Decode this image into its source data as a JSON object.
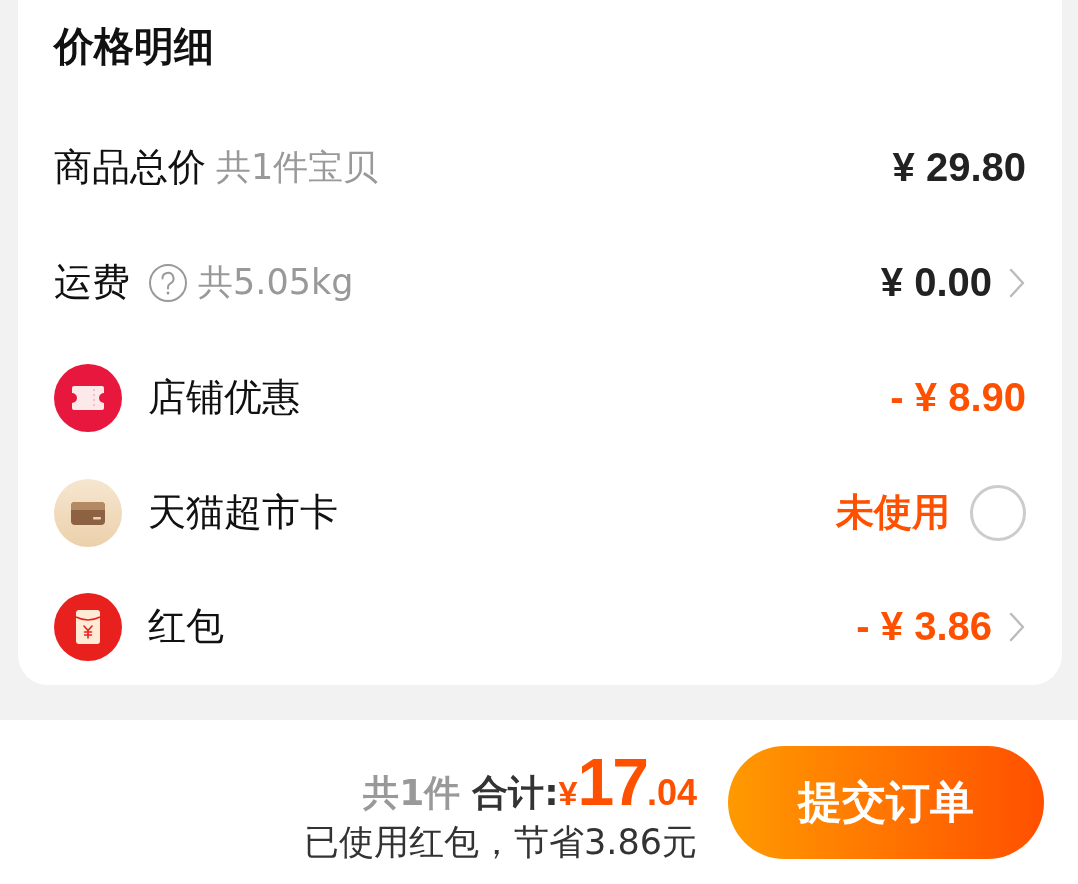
{
  "card": {
    "title": "价格明细",
    "rows": [
      {
        "kind": "charge",
        "label": "商品总价",
        "help": false,
        "note": "共1件宝贝",
        "amount": "¥ 29.80",
        "chevron": false
      },
      {
        "kind": "charge",
        "label": "运费",
        "help": true,
        "note": "共5.05kg",
        "amount": "¥ 0.00",
        "chevron": true
      },
      {
        "kind": "discount",
        "label": "店铺优惠",
        "amount": "- ¥ 8.90",
        "chevron": false
      },
      {
        "kind": "option",
        "label": "天猫超市卡",
        "status": "未使用",
        "checked": false
      },
      {
        "kind": "discount",
        "label": "红包",
        "amount": "- ¥ 3.86",
        "chevron": true
      }
    ]
  },
  "footer": {
    "item_count": "共1件",
    "total_label": "合计:",
    "total": {
      "currency": "¥",
      "integer": "17",
      "decimal": ".04"
    },
    "savings": "已使用红包，节省3.86元",
    "submit_button": "提交订单"
  }
}
